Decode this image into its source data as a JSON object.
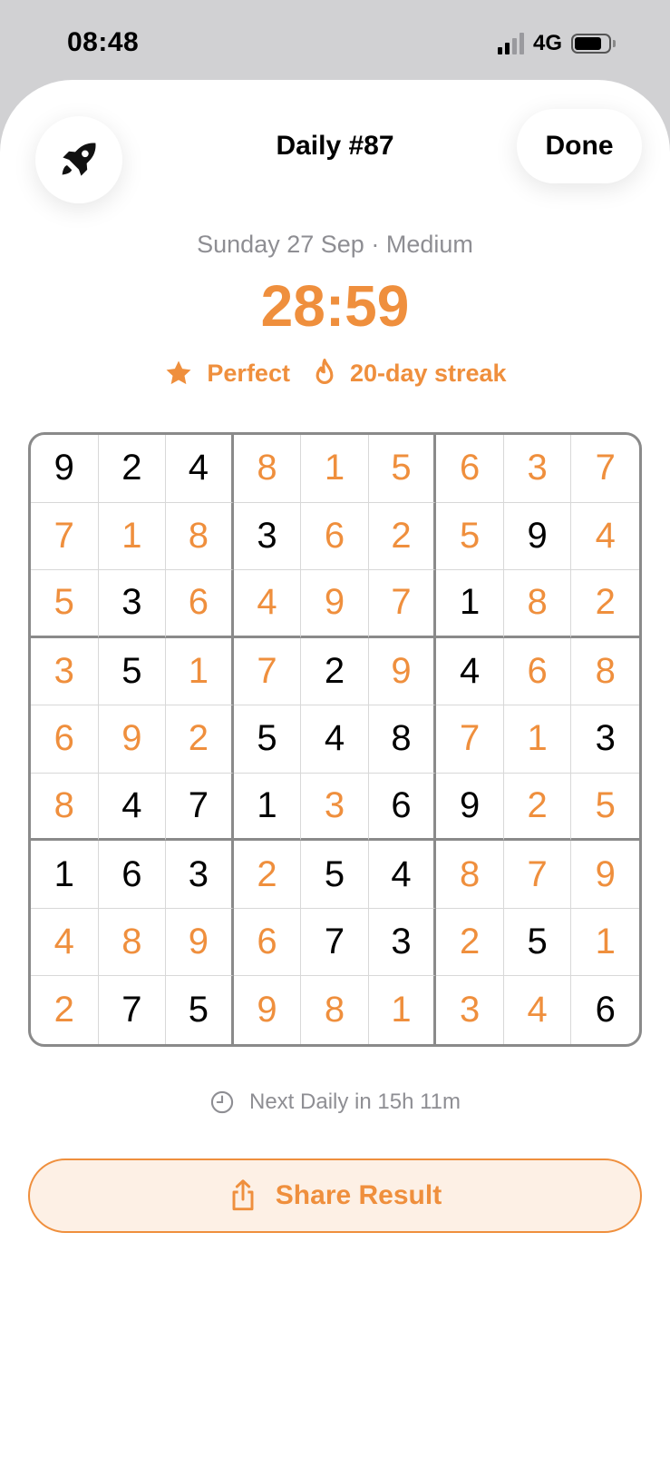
{
  "status_bar": {
    "time": "08:48",
    "network": "4G"
  },
  "header": {
    "title": "Daily #87",
    "done_label": "Done",
    "left_icon": "rocket-icon"
  },
  "puzzle_info": {
    "date": "Sunday 27 Sep",
    "difficulty": "Medium",
    "separator": "·",
    "time": "28:59"
  },
  "badges": {
    "perfect": "Perfect",
    "streak": "20-day streak"
  },
  "grid": {
    "rows": [
      [
        "9",
        "2",
        "4",
        "8",
        "1",
        "5",
        "6",
        "3",
        "7"
      ],
      [
        "7",
        "1",
        "8",
        "3",
        "6",
        "2",
        "5",
        "9",
        "4"
      ],
      [
        "5",
        "3",
        "6",
        "4",
        "9",
        "7",
        "1",
        "8",
        "2"
      ],
      [
        "3",
        "5",
        "1",
        "7",
        "2",
        "9",
        "4",
        "6",
        "8"
      ],
      [
        "6",
        "9",
        "2",
        "5",
        "4",
        "8",
        "7",
        "1",
        "3"
      ],
      [
        "8",
        "4",
        "7",
        "1",
        "3",
        "6",
        "9",
        "2",
        "5"
      ],
      [
        "1",
        "6",
        "3",
        "2",
        "5",
        "4",
        "8",
        "7",
        "9"
      ],
      [
        "4",
        "8",
        "9",
        "6",
        "7",
        "3",
        "2",
        "5",
        "1"
      ],
      [
        "2",
        "7",
        "5",
        "9",
        "8",
        "1",
        "3",
        "4",
        "6"
      ]
    ],
    "filled_by_user": [
      [
        0,
        0,
        0,
        1,
        1,
        1,
        1,
        1,
        1
      ],
      [
        1,
        1,
        1,
        0,
        1,
        1,
        1,
        0,
        1
      ],
      [
        1,
        0,
        1,
        1,
        1,
        1,
        0,
        1,
        1
      ],
      [
        1,
        0,
        1,
        1,
        0,
        1,
        0,
        1,
        1
      ],
      [
        1,
        1,
        1,
        0,
        0,
        0,
        1,
        1,
        0
      ],
      [
        1,
        0,
        0,
        0,
        1,
        0,
        0,
        1,
        1
      ],
      [
        0,
        0,
        0,
        1,
        0,
        0,
        1,
        1,
        1
      ],
      [
        1,
        1,
        1,
        1,
        0,
        0,
        1,
        0,
        1
      ],
      [
        1,
        0,
        0,
        1,
        1,
        1,
        1,
        1,
        0
      ]
    ],
    "given_color": "#000000",
    "user_color": "#ef8f3d"
  },
  "next_daily": "Next Daily in 15h 11m",
  "share_label": "Share Result",
  "colors": {
    "accent": "#ef8f3d",
    "accent_bg": "#fdf0e5",
    "muted": "#8e8e93"
  }
}
